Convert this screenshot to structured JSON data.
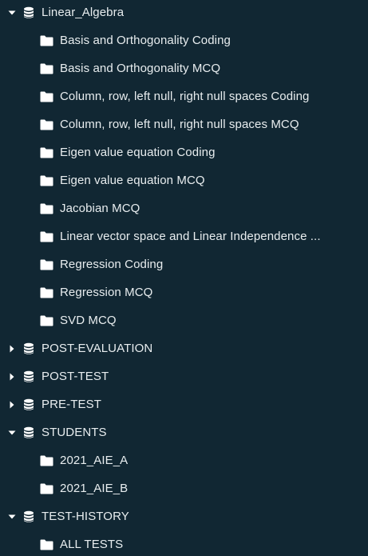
{
  "colors": {
    "background": "#112733",
    "text": "#e8edef",
    "icon": "#ffffff"
  },
  "tree": [
    {
      "type": "database",
      "label": "Linear_Algebra",
      "expanded": true,
      "icon": "database-icon"
    },
    {
      "type": "folder",
      "label": "Basis and Orthogonality Coding",
      "icon": "folder-icon"
    },
    {
      "type": "folder",
      "label": "Basis and Orthogonality MCQ",
      "icon": "folder-icon"
    },
    {
      "type": "folder",
      "label": "Column, row, left null, right null spaces Coding",
      "icon": "folder-icon"
    },
    {
      "type": "folder",
      "label": "Column, row, left null, right null spaces MCQ",
      "icon": "folder-icon"
    },
    {
      "type": "folder",
      "label": "Eigen value equation Coding",
      "icon": "folder-icon"
    },
    {
      "type": "folder",
      "label": "Eigen value equation MCQ",
      "icon": "folder-icon"
    },
    {
      "type": "folder",
      "label": "Jacobian MCQ",
      "icon": "folder-icon"
    },
    {
      "type": "folder",
      "label": "Linear vector space and Linear Independence ...",
      "icon": "folder-icon"
    },
    {
      "type": "folder",
      "label": "Regression Coding",
      "icon": "folder-icon"
    },
    {
      "type": "folder",
      "label": "Regression MCQ",
      "icon": "folder-icon"
    },
    {
      "type": "folder",
      "label": "SVD MCQ",
      "icon": "folder-icon"
    },
    {
      "type": "database",
      "label": "POST-EVALUATION",
      "expanded": false,
      "icon": "database-icon"
    },
    {
      "type": "database",
      "label": "POST-TEST",
      "expanded": false,
      "icon": "database-icon"
    },
    {
      "type": "database",
      "label": "PRE-TEST",
      "expanded": false,
      "icon": "database-icon"
    },
    {
      "type": "database",
      "label": "STUDENTS",
      "expanded": true,
      "icon": "database-icon"
    },
    {
      "type": "folder",
      "label": "2021_AIE_A",
      "icon": "folder-icon"
    },
    {
      "type": "folder",
      "label": "2021_AIE_B",
      "icon": "folder-icon"
    },
    {
      "type": "database",
      "label": "TEST-HISTORY",
      "expanded": true,
      "icon": "database-icon"
    },
    {
      "type": "folder",
      "label": "ALL TESTS",
      "icon": "folder-icon"
    }
  ]
}
